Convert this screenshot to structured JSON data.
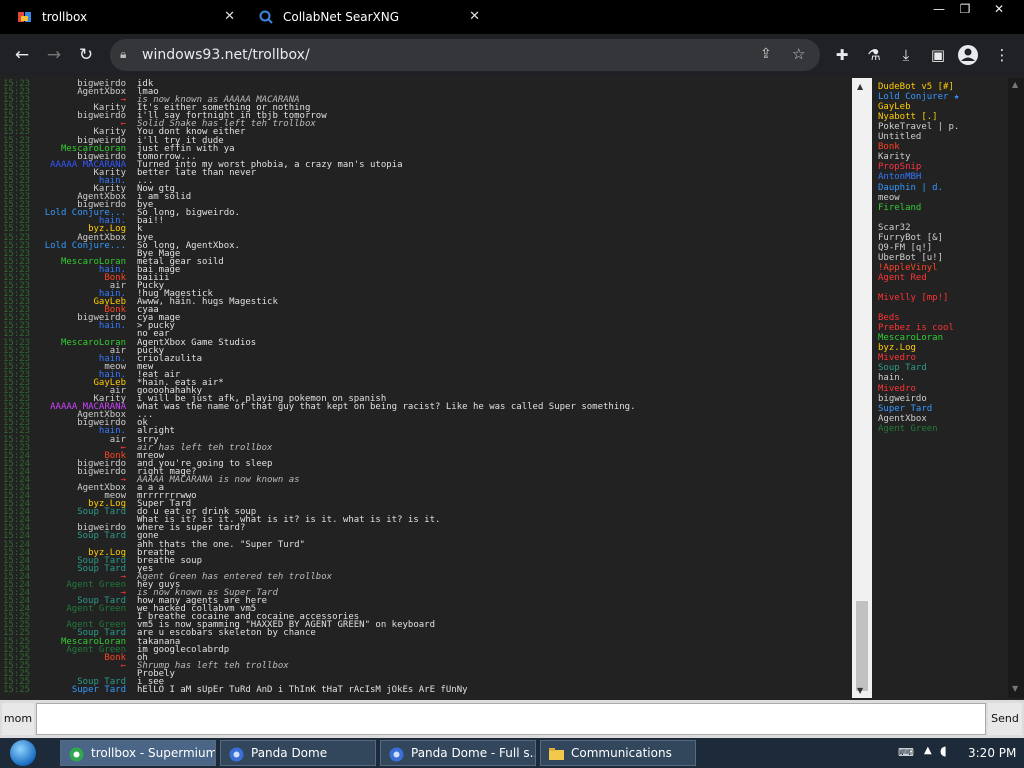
{
  "browser": {
    "tabs": [
      {
        "title": "trollbox"
      },
      {
        "title": "CollabNet SearXNG"
      }
    ],
    "url": "windows93.net/trollbox/"
  },
  "chat": {
    "lines": [
      {
        "ts": "15:23",
        "nick": "bigweirdo",
        "nick_color": "#cfcfcf",
        "text": "idk"
      },
      {
        "ts": "15:23",
        "nick": "AgentXbox",
        "nick_color": "#cfcfcf",
        "text": "lmao"
      },
      {
        "ts": "15:23",
        "nick": "→",
        "nick_color": "#ff3333",
        "text": "is now known as AAAAA MACARANA",
        "system": true
      },
      {
        "ts": "15:23",
        "nick": "Karity",
        "nick_color": "#cfcfcf",
        "text": "It's either something or nothing"
      },
      {
        "ts": "15:23",
        "nick": "bigweirdo",
        "nick_color": "#cfcfcf",
        "text": "i'll say fortnight in tbjb tomorrow"
      },
      {
        "ts": "15:23",
        "nick": "←",
        "nick_color": "#ff3333",
        "text": "Solid Snake has left teh trollbox",
        "system": true
      },
      {
        "ts": "15:23",
        "nick": "Karity",
        "nick_color": "#cfcfcf",
        "text": "You dont know either"
      },
      {
        "ts": "15:23",
        "nick": "bigweirdo",
        "nick_color": "#cfcfcf",
        "text": "i'll try it dude"
      },
      {
        "ts": "15:23",
        "nick": "MescaroLoran",
        "nick_color": "#33cc33",
        "text": "just effin with ya"
      },
      {
        "ts": "15:23",
        "nick": "bigweirdo",
        "nick_color": "#cfcfcf",
        "text": "tomorrow..."
      },
      {
        "ts": "15:23",
        "nick": "AAAAA MACARANA",
        "nick_color": "#3355ff",
        "text": "Turned into my worst phobia, a crazy man's utopia"
      },
      {
        "ts": "15:23",
        "nick": "Karity",
        "nick_color": "#cfcfcf",
        "text": "better late than never"
      },
      {
        "ts": "15:23",
        "nick": "hain.",
        "nick_color": "#3377ff",
        "text": "..."
      },
      {
        "ts": "15:23",
        "nick": "Karity",
        "nick_color": "#cfcfcf",
        "text": "Now gtg"
      },
      {
        "ts": "15:23",
        "nick": "AgentXbox",
        "nick_color": "#cfcfcf",
        "text": "i am solid"
      },
      {
        "ts": "15:23",
        "nick": "bigweirdo",
        "nick_color": "#cfcfcf",
        "text": "bye"
      },
      {
        "ts": "15:23",
        "nick": "Lold Conjure...",
        "nick_color": "#3399ff",
        "text": "So long, bigweirdo."
      },
      {
        "ts": "15:23",
        "nick": "hain.",
        "nick_color": "#3377ff",
        "text": "bai!!"
      },
      {
        "ts": "15:23",
        "nick": "byz.Log",
        "nick_color": "#ffcc00",
        "text": "k"
      },
      {
        "ts": "15:23",
        "nick": "AgentXbox",
        "nick_color": "#cfcfcf",
        "text": "bye"
      },
      {
        "ts": "15:23",
        "nick": "Lold Conjure...",
        "nick_color": "#3399ff",
        "text": "So long, AgentXbox."
      },
      {
        "ts": "15:23",
        "nick": "",
        "nick_color": "#cfcfcf",
        "text": "Bye Mage"
      },
      {
        "ts": "15:23",
        "nick": "MescaroLoran",
        "nick_color": "#33cc33",
        "text": "metal gear soild"
      },
      {
        "ts": "15:23",
        "nick": "hain.",
        "nick_color": "#3377ff",
        "text": "bai mage"
      },
      {
        "ts": "15:23",
        "nick": "Bonk",
        "nick_color": "#ff4422",
        "text": "baiiii"
      },
      {
        "ts": "15:23",
        "nick": "air",
        "nick_color": "#cfcfcf",
        "text": "Pucky"
      },
      {
        "ts": "15:23",
        "nick": "hain.",
        "nick_color": "#3377ff",
        "text": "!hug Magestick"
      },
      {
        "ts": "15:23",
        "nick": "GayLeb",
        "nick_color": "#ffcc00",
        "text": "Awww, hain. hugs Magestick"
      },
      {
        "ts": "15:23",
        "nick": "Bonk",
        "nick_color": "#ff4422",
        "text": "cyaa"
      },
      {
        "ts": "15:23",
        "nick": "bigweirdo",
        "nick_color": "#cfcfcf",
        "text": "cya mage"
      },
      {
        "ts": "15:23",
        "nick": "hain.",
        "nick_color": "#3377ff",
        "text": "> pucky"
      },
      {
        "ts": "15:23",
        "nick": "",
        "nick_color": "#cfcfcf",
        "text": "no ear"
      },
      {
        "ts": "15:23",
        "nick": "MescaroLoran",
        "nick_color": "#33cc33",
        "text": "AgentXbox Game Studios"
      },
      {
        "ts": "15:23",
        "nick": "air",
        "nick_color": "#cfcfcf",
        "text": "pucky"
      },
      {
        "ts": "15:23",
        "nick": "hain.",
        "nick_color": "#3377ff",
        "text": "criolazulita"
      },
      {
        "ts": "15:23",
        "nick": "meow",
        "nick_color": "#cfcfcf",
        "text": "mew"
      },
      {
        "ts": "15:23",
        "nick": "hain.",
        "nick_color": "#3377ff",
        "text": "!eat air"
      },
      {
        "ts": "15:23",
        "nick": "GayLeb",
        "nick_color": "#ffcc00",
        "text": "*hain. eats air*"
      },
      {
        "ts": "15:23",
        "nick": "air",
        "nick_color": "#cfcfcf",
        "text": "goooohahahky"
      },
      {
        "ts": "15:23",
        "nick": "Karity",
        "nick_color": "#cfcfcf",
        "text": "i will be just afk, playing pokemon on spanish"
      },
      {
        "ts": "15:23",
        "nick": "AAAAA MACARANA",
        "nick_color": "#cc44ff",
        "text": "what was the name of that guy that kept on being racist? Like he was called Super something."
      },
      {
        "ts": "15:23",
        "nick": "AgentXbox",
        "nick_color": "#cfcfcf",
        "text": "..."
      },
      {
        "ts": "15:23",
        "nick": "bigweirdo",
        "nick_color": "#cfcfcf",
        "text": "ok"
      },
      {
        "ts": "15:23",
        "nick": "hain.",
        "nick_color": "#3377ff",
        "text": "alright"
      },
      {
        "ts": "15:23",
        "nick": "air",
        "nick_color": "#cfcfcf",
        "text": "srry"
      },
      {
        "ts": "15:23",
        "nick": "←",
        "nick_color": "#ff3333",
        "text": "air has left teh trollbox",
        "system": true
      },
      {
        "ts": "15:24",
        "nick": "Bonk",
        "nick_color": "#ff4422",
        "text": "mreow"
      },
      {
        "ts": "15:24",
        "nick": "bigweirdo",
        "nick_color": "#cfcfcf",
        "text": "and you're going to sleep"
      },
      {
        "ts": "15:24",
        "nick": "bigweirdo",
        "nick_color": "#cfcfcf",
        "text": "right mage?"
      },
      {
        "ts": "15:24",
        "nick": "→",
        "nick_color": "#ff3333",
        "text": "AAAAA MACARANA is now known as",
        "system": true
      },
      {
        "ts": "15:24",
        "nick": "AgentXbox",
        "nick_color": "#cfcfcf",
        "text": "a a a"
      },
      {
        "ts": "15:24",
        "nick": "meow",
        "nick_color": "#cfcfcf",
        "text": "mrrrrrrrwwo"
      },
      {
        "ts": "15:24",
        "nick": "byz.Log",
        "nick_color": "#ffcc00",
        "text": "Super Tard"
      },
      {
        "ts": "15:24",
        "nick": "Soup Tard",
        "nick_color": "#2d9a8a",
        "text": "do u eat or drink soup"
      },
      {
        "ts": "15:24",
        "nick": "",
        "nick_color": "#3355ff",
        "text": "What is it? is it. what is it? is it. what is it? is it."
      },
      {
        "ts": "15:24",
        "nick": "bigweirdo",
        "nick_color": "#cfcfcf",
        "text": "where is super tard?"
      },
      {
        "ts": "15:24",
        "nick": "Soup Tard",
        "nick_color": "#2d9a8a",
        "text": "gone"
      },
      {
        "ts": "15:24",
        "nick": "",
        "nick_color": "#cfcfcf",
        "text": "ahh thats the one. \"Super Turd\""
      },
      {
        "ts": "15:24",
        "nick": "byz.Log",
        "nick_color": "#ffcc00",
        "text": "breathe"
      },
      {
        "ts": "15:24",
        "nick": "Soup Tard",
        "nick_color": "#2d9a8a",
        "text": "breathe soup"
      },
      {
        "ts": "15:24",
        "nick": "Soup Tard",
        "nick_color": "#2d9a8a",
        "text": "yes"
      },
      {
        "ts": "15:24",
        "nick": "→",
        "nick_color": "#ff3333",
        "text": "Agent Green has entered teh trollbox",
        "system": true
      },
      {
        "ts": "15:24",
        "nick": "Agent Green",
        "nick_color": "#1f7a3a",
        "text": "hey guys"
      },
      {
        "ts": "15:24",
        "nick": "→",
        "nick_color": "#ff3333",
        "text": "is now known as Super Tard",
        "system": true
      },
      {
        "ts": "15:24",
        "nick": "Soup Tard",
        "nick_color": "#2d9a8a",
        "text": "how many agents are here"
      },
      {
        "ts": "15:24",
        "nick": "Agent Green",
        "nick_color": "#1f7a3a",
        "text": "we hacked collabvm vm5"
      },
      {
        "ts": "15:25",
        "nick": "",
        "nick_color": "#3355ff",
        "text": "I breathe cocaine and cocaine accessories"
      },
      {
        "ts": "15:25",
        "nick": "Agent Green",
        "nick_color": "#1f7a3a",
        "text": "vm5 is now spamming \"HAXXED BY AGENT GREEN\" on keyboard"
      },
      {
        "ts": "15:25",
        "nick": "Soup Tard",
        "nick_color": "#2d9a8a",
        "text": "are u escobars skeleton by chance"
      },
      {
        "ts": "15:25",
        "nick": "MescaroLoran",
        "nick_color": "#33cc33",
        "text": "takanana"
      },
      {
        "ts": "15:25",
        "nick": "Agent Green",
        "nick_color": "#1f7a3a",
        "text": "im googlecolabrdp"
      },
      {
        "ts": "15:25",
        "nick": "Bonk",
        "nick_color": "#ff4422",
        "text": "oh"
      },
      {
        "ts": "15:25",
        "nick": "←",
        "nick_color": "#ff3333",
        "text": "Shrump has left teh trollbox",
        "system": true
      },
      {
        "ts": "15:25",
        "nick": "",
        "nick_color": "#3355ff",
        "text": "Probely"
      },
      {
        "ts": "15:25",
        "nick": "Soup Tard",
        "nick_color": "#2d9a8a",
        "text": "i see"
      },
      {
        "ts": "15:25",
        "nick": "Super Tard",
        "nick_color": "#3399ff",
        "text": "hElLO I aM sUpEr TuRd AnD i ThInK tHaT rAcIsM jOkEs ArE fUnNy"
      }
    ]
  },
  "users": [
    {
      "name": "DudeBot v5 [#]",
      "color": "#ffcc00"
    },
    {
      "name": "Lold Conjurer ★",
      "color": "#3399ff"
    },
    {
      "name": "GayLeb",
      "color": "#ffcc00"
    },
    {
      "name": "Nyabott [.]",
      "color": "#ffcc00"
    },
    {
      "name": "PokeTravel | p.",
      "color": "#cfcfcf"
    },
    {
      "name": "Untitled",
      "color": "#cfcfcf"
    },
    {
      "name": "Bonk",
      "color": "#ff4422"
    },
    {
      "name": "Karity",
      "color": "#cfcfcf"
    },
    {
      "name": "PropSnip",
      "color": "#ff3344"
    },
    {
      "name": "AntonMBH",
      "color": "#3377ff"
    },
    {
      "name": "Dauphin | d.",
      "color": "#3399ff"
    },
    {
      "name": "meow",
      "color": "#cfcfcf"
    },
    {
      "name": "Fireland",
      "color": "#33cc33"
    },
    {
      "name": "",
      "color": "#888888"
    },
    {
      "name": "Scar32",
      "color": "#cfcfcf"
    },
    {
      "name": "FurryBot [&]",
      "color": "#cfcfcf"
    },
    {
      "name": "Q9-FM [q!]",
      "color": "#cfcfcf"
    },
    {
      "name": "UberBot [u!]",
      "color": "#cfcfcf"
    },
    {
      "name": "!AppleVinyl",
      "color": "#ff4422"
    },
    {
      "name": "Agent Red",
      "color": "#ff3333"
    },
    {
      "name": "",
      "color": "#1f7a3a"
    },
    {
      "name": "Mivelly [mp!]",
      "color": "#ff3333"
    },
    {
      "name": "",
      "color": "#3355ff"
    },
    {
      "name": "Beds",
      "color": "#ff3333"
    },
    {
      "name": "Prebez is cool",
      "color": "#ff3333"
    },
    {
      "name": "MescaroLoran",
      "color": "#33cc33"
    },
    {
      "name": "byz.Log",
      "color": "#ffcc00"
    },
    {
      "name": "Mivedro",
      "color": "#ff3333"
    },
    {
      "name": "Soup Tard",
      "color": "#2d9a8a"
    },
    {
      "name": "hain.",
      "color": "#cfcfcf"
    },
    {
      "name": "Mivedro",
      "color": "#ff3333"
    },
    {
      "name": "bigweirdo",
      "color": "#cfcfcf"
    },
    {
      "name": "Super Tard",
      "color": "#3399ff"
    },
    {
      "name": "AgentXbox",
      "color": "#cfcfcf"
    },
    {
      "name": "Agent Green",
      "color": "#1f7a3a"
    }
  ],
  "input": {
    "nick_label": "mom",
    "message_value": "",
    "send_label": "Send"
  },
  "taskbar": {
    "items": [
      {
        "label": "trollbox - Supermium"
      },
      {
        "label": "Panda Dome"
      },
      {
        "label": "Panda Dome - Full s..."
      },
      {
        "label": "Communications"
      }
    ],
    "clock": "3:20 PM"
  }
}
